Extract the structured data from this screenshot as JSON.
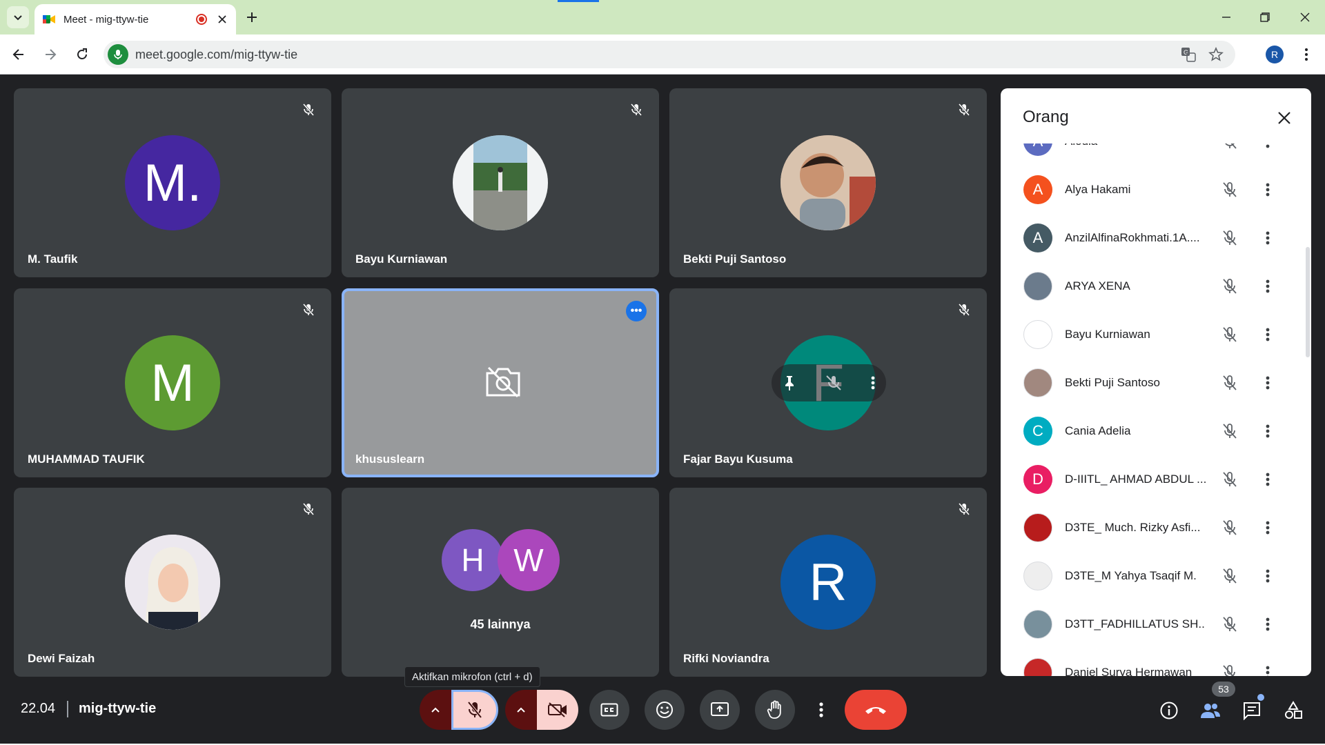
{
  "browser": {
    "tab_title": "Meet - mig-ttyw-tie",
    "url": "meet.google.com/mig-ttyw-tie",
    "profile_initial": "R"
  },
  "tiles": [
    {
      "name": "M. Taufik",
      "initial": "M.",
      "color": "#4527a0",
      "kind": "letter"
    },
    {
      "name": "Bayu Kurniawan",
      "kind": "photo",
      "photo": "landscape"
    },
    {
      "name": "Bekti Puji Santoso",
      "kind": "photo",
      "photo": "child"
    },
    {
      "name": "MUHAMMAD TAUFIK",
      "initial": "M",
      "color": "#5d9b32",
      "kind": "letter"
    },
    {
      "name": "khususlearn",
      "kind": "self"
    },
    {
      "name": "Fajar Bayu Kusuma",
      "initial": "F",
      "color": "#00897b",
      "kind": "hover"
    },
    {
      "name": "Dewi Faizah",
      "kind": "photo",
      "photo": "hijab"
    },
    {
      "name": "45 lainnya",
      "kind": "others",
      "others": [
        {
          "initial": "H",
          "color": "#7e57c2"
        },
        {
          "initial": "W",
          "color": "#ab47bc"
        }
      ]
    },
    {
      "name": "Rifki Noviandra",
      "initial": "R",
      "color": "#0b57a4",
      "kind": "letter"
    }
  ],
  "people_panel": {
    "title": "Orang",
    "participants": [
      {
        "name": "Alodia",
        "initial": "A",
        "color": "#5c6bc0"
      },
      {
        "name": "Alya Hakami",
        "initial": "A",
        "color": "#f4511e"
      },
      {
        "name": "AnzilAlfinaRokhmati.1A....",
        "initial": "A",
        "color": "#455a64"
      },
      {
        "name": "ARYA XENA",
        "initial": "",
        "color": "#6b7b8c",
        "photo": true
      },
      {
        "name": "Bayu Kurniawan",
        "initial": "",
        "color": "#ffffff",
        "photo": true
      },
      {
        "name": "Bekti Puji Santoso",
        "initial": "",
        "color": "#a1887f",
        "photo": true
      },
      {
        "name": "Cania Adelia",
        "initial": "C",
        "color": "#00acc1"
      },
      {
        "name": "D-IIITL_ AHMAD ABDUL ...",
        "initial": "D",
        "color": "#e91e63"
      },
      {
        "name": "D3TE_ Much. Rizky Asfi...",
        "initial": "",
        "color": "#b71c1c",
        "photo": true
      },
      {
        "name": "D3TE_M Yahya Tsaqif M.",
        "initial": "",
        "color": "#eeeeee",
        "photo": true
      },
      {
        "name": "D3TT_FADHILLATUS SH...",
        "initial": "",
        "color": "#78909c",
        "photo": true
      },
      {
        "name": "Daniel Surya Hermawan",
        "initial": "",
        "color": "#c62828",
        "photo": true
      }
    ]
  },
  "bottom": {
    "time": "22.04",
    "meeting_code": "mig-ttyw-tie",
    "tooltip": "Aktifkan mikrofon (ctrl + d)",
    "participant_count": "53"
  },
  "colors": {
    "accent": "#1a73e8",
    "end_call": "#ea4335",
    "background": "#202124"
  }
}
